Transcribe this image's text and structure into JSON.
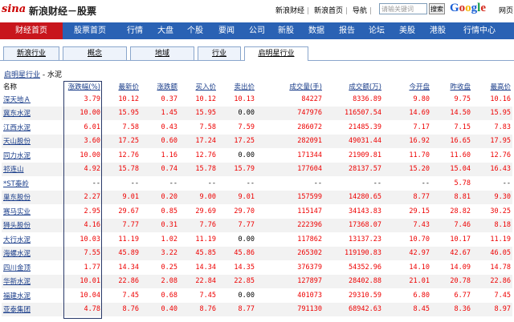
{
  "header": {
    "logo": "sina",
    "title": "新浪财经－股票",
    "links": [
      "新浪财经",
      "新浪首页",
      "导航"
    ],
    "search_placeholder": "请输关键词",
    "search_button": "搜索",
    "google": "Google",
    "extra": "网页"
  },
  "nav": {
    "home": "财经首页",
    "items": [
      "股票首页",
      "行情",
      "大盘",
      "个股",
      "要闻",
      "公司",
      "新股",
      "数据",
      "报告",
      "论坛",
      "美股",
      "港股",
      "行情中心"
    ]
  },
  "subtabs": [
    "新浪行业",
    "概念",
    "地域",
    "行业",
    "启明星行业"
  ],
  "active_tab": "启明星行业",
  "breadcrumb": {
    "link": "启明星行业",
    "sep": " - ",
    "current": "水泥"
  },
  "table": {
    "columns": [
      "名称",
      "涨跌幅(%)",
      "最新价",
      "涨跌额",
      "买入价",
      "卖出价",
      "成交量(手)",
      "成交额(万)",
      "今开盘",
      "昨收盘",
      "最高价"
    ],
    "rows": [
      [
        "深天地Ａ",
        "3.79",
        "10.12",
        "0.37",
        "10.12",
        "10.13",
        "84227",
        "8336.89",
        "9.80",
        "9.75",
        "10.16"
      ],
      [
        "冀东水泥",
        "10.00",
        "15.95",
        "1.45",
        "15.95",
        "0.00",
        "747976",
        "116507.54",
        "14.69",
        "14.50",
        "15.95"
      ],
      [
        "江西水泥",
        "6.01",
        "7.58",
        "0.43",
        "7.58",
        "7.59",
        "286072",
        "21485.39",
        "7.17",
        "7.15",
        "7.83"
      ],
      [
        "天山股份",
        "3.60",
        "17.25",
        "0.60",
        "17.24",
        "17.25",
        "282091",
        "49031.44",
        "16.92",
        "16.65",
        "17.95"
      ],
      [
        "同力水泥",
        "10.00",
        "12.76",
        "1.16",
        "12.76",
        "0.00",
        "171344",
        "21909.81",
        "11.70",
        "11.60",
        "12.76"
      ],
      [
        "祁连山",
        "4.92",
        "15.78",
        "0.74",
        "15.78",
        "15.79",
        "177604",
        "28137.57",
        "15.20",
        "15.04",
        "16.43"
      ],
      [
        "*ST秦岭",
        "--",
        "--",
        "--",
        "--",
        "--",
        "--",
        "--",
        "--",
        "5.78",
        "--"
      ],
      [
        "巢东股份",
        "2.27",
        "9.01",
        "0.20",
        "9.00",
        "9.01",
        "157599",
        "14280.65",
        "8.77",
        "8.81",
        "9.30"
      ],
      [
        "赛马实业",
        "2.95",
        "29.67",
        "0.85",
        "29.69",
        "29.70",
        "115147",
        "34143.83",
        "29.15",
        "28.82",
        "30.25"
      ],
      [
        "狮头股份",
        "4.16",
        "7.77",
        "0.31",
        "7.76",
        "7.77",
        "222396",
        "17368.07",
        "7.43",
        "7.46",
        "8.18"
      ],
      [
        "大行水泥",
        "10.03",
        "11.19",
        "1.02",
        "11.19",
        "0.00",
        "117862",
        "13137.23",
        "10.70",
        "10.17",
        "11.19"
      ],
      [
        "海螺水泥",
        "7.55",
        "45.89",
        "3.22",
        "45.85",
        "45.86",
        "265302",
        "119190.83",
        "42.97",
        "42.67",
        "46.05"
      ],
      [
        "四川金顶",
        "1.77",
        "14.34",
        "0.25",
        "14.34",
        "14.35",
        "376379",
        "54352.96",
        "14.10",
        "14.09",
        "14.78"
      ],
      [
        "华新水泥",
        "10.01",
        "22.86",
        "2.08",
        "22.84",
        "22.85",
        "127897",
        "28402.88",
        "21.01",
        "20.78",
        "22.86"
      ],
      [
        "福建水泥",
        "10.04",
        "7.45",
        "0.68",
        "7.45",
        "0.00",
        "401073",
        "29310.59",
        "6.80",
        "6.77",
        "7.45"
      ],
      [
        "亚泰集团",
        "4.78",
        "8.76",
        "0.40",
        "8.76",
        "8.77",
        "791130",
        "68942.63",
        "8.45",
        "8.36",
        "8.97"
      ]
    ]
  }
}
